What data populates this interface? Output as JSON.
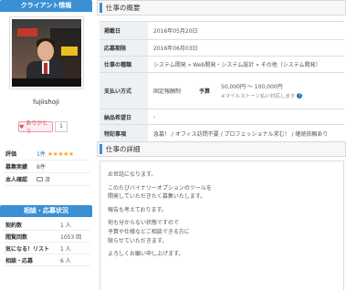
{
  "client_section": {
    "heading": "クライアント情報"
  },
  "client": {
    "username": "fujiishoji",
    "thanks_label": "ありがとう",
    "thanks_count": "1"
  },
  "profile": {
    "rating_label": "評価",
    "rating_count": "1件",
    "rating_stars": "★★★★★",
    "posted_label": "募集実績",
    "posted_value": "8件",
    "verified_label": "本人確認",
    "verified_value": "済"
  },
  "stats_section": {
    "heading": "相談・応募状況"
  },
  "stats": [
    {
      "label": "契約数",
      "value": "1 人"
    },
    {
      "label": "閲覧回数",
      "value": "1053 回"
    },
    {
      "label": "気になる！リスト",
      "value": "1 人"
    },
    {
      "label": "相談・応募",
      "value": "6 人"
    }
  ],
  "summary_section": {
    "heading": "仕事の概要"
  },
  "summary": {
    "start_label": "掲載日",
    "start_value": "2016年05月20日",
    "deadline_label": "応募期限",
    "deadline_value": "2016年06月03日",
    "category_label": "仕事の種類",
    "category_value": "システム開発 » Web開発・システム設計 » その他（システム開発）",
    "pay_label": "支払い方式",
    "pay_kind": "固定報酬制",
    "budget_label": "予算",
    "budget_value": "50,000円 〜 100,000円",
    "budget_note": "※マイルストーン払い対応します",
    "delivery_label": "納品希望日",
    "delivery_value": "-",
    "features_label": "特記事項",
    "features_value": "急募！ / オフィス訪問不要 / プロフェッショナル求む！ / 継続依頼あり"
  },
  "detail_section": {
    "heading": "仕事の詳細"
  },
  "detail": {
    "p1": "お世話になります。",
    "p2a": "このたびバイナリーオプションのツールを",
    "p2b": "開発していただきたく募集いたします。",
    "p3": "報告も考えております。",
    "p4a": "何も分からない状態ですので",
    "p4b": "予算や仕様などご相談できる方に",
    "p4c": "限らせていただきます。",
    "p5": "よろしくお願い申し上げます。"
  },
  "colors": {
    "accent": "#3b8fd4",
    "link": "#2a6ebb",
    "star": "#f5a623",
    "thanks": "#d24f6a"
  }
}
